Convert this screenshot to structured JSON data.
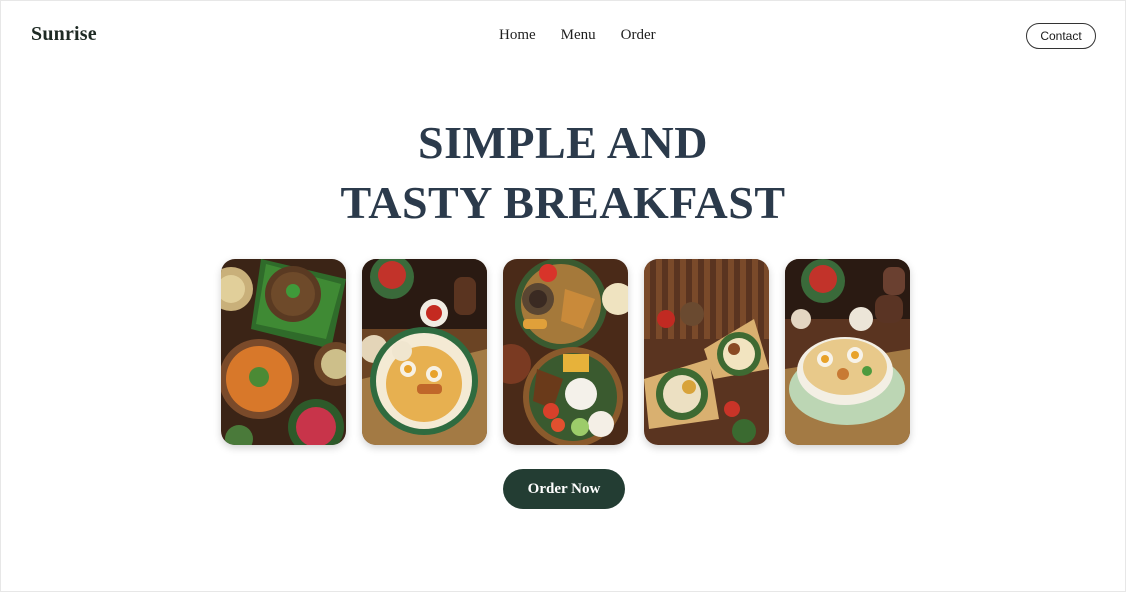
{
  "header": {
    "brand": "Sunrise",
    "nav": [
      {
        "label": "Home"
      },
      {
        "label": "Menu"
      },
      {
        "label": "Order"
      }
    ],
    "contact_label": "Contact"
  },
  "hero": {
    "title_line1": "SIMPLE AND",
    "title_line2": "TASTY BREAKFAST",
    "cta_label": "Order Now"
  },
  "gallery": [
    {
      "name": "food-photo-1"
    },
    {
      "name": "food-photo-2"
    },
    {
      "name": "food-photo-3"
    },
    {
      "name": "food-photo-4"
    },
    {
      "name": "food-photo-5"
    }
  ],
  "colors": {
    "title": "#2b3a4b",
    "cta_bg": "#233d33",
    "brand": "#1e2a24"
  }
}
